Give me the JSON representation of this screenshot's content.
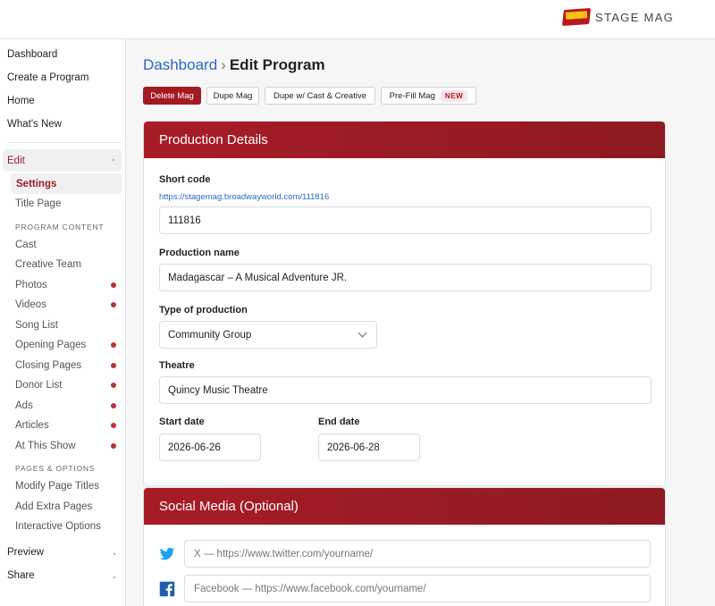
{
  "brand": {
    "name": "STAGE MAG",
    "logo_icon": "stagemag-logo-icon"
  },
  "sidebar": {
    "top_items": [
      "Dashboard",
      "Create a Program",
      "Home",
      "What's New"
    ],
    "edit_label": "Edit",
    "settings_label": "Settings",
    "title_page_label": "Title Page",
    "program_content_heading": "PROGRAM CONTENT",
    "program_content": [
      {
        "label": "Cast",
        "dot": false
      },
      {
        "label": "Creative Team",
        "dot": false
      },
      {
        "label": "Photos",
        "dot": true
      },
      {
        "label": "Videos",
        "dot": true
      },
      {
        "label": "Song List",
        "dot": false
      },
      {
        "label": "Opening Pages",
        "dot": true
      },
      {
        "label": "Closing Pages",
        "dot": true
      },
      {
        "label": "Donor List",
        "dot": true
      },
      {
        "label": "Ads",
        "dot": true
      },
      {
        "label": "Articles",
        "dot": true
      },
      {
        "label": "At This Show",
        "dot": true
      }
    ],
    "pages_options_heading": "PAGES & OPTIONS",
    "pages_options": [
      "Modify Page Titles",
      "Add Extra Pages",
      "Interactive Options"
    ],
    "preview_label": "Preview",
    "share_label": "Share",
    "dot_color": "#b73239"
  },
  "breadcrumb": {
    "parent": "Dashboard",
    "separator": "›",
    "current": "Edit Program"
  },
  "actions": {
    "delete": "Delete Mag",
    "dupe": "Dupe Mag",
    "dupe_cast": "Dupe w/ Cast & Creative",
    "prefill": "Pre-Fill Mag",
    "new_badge": "NEW"
  },
  "production": {
    "heading": "Production Details",
    "short_code_label": "Short code",
    "short_code_url": "https://stagemag.broadwayworld.com/111816",
    "short_code_value": "111816",
    "production_name_label": "Production name",
    "production_name_value": "Madagascar – A Musical Adventure JR.",
    "type_label": "Type of production",
    "type_value": "Community Group",
    "theatre_label": "Theatre",
    "theatre_value": "Quincy Music Theatre",
    "start_label": "Start date",
    "start_value": "2026-06-26",
    "end_label": "End date",
    "end_value": "2026-06-28"
  },
  "social": {
    "heading": "Social Media (Optional)",
    "twitter_placeholder": "X — https://www.twitter.com/yourname/",
    "facebook_placeholder": "Facebook — https://www.facebook.com/yourname/"
  },
  "colors": {
    "accent": "#a31a23",
    "link": "#2c68c3",
    "twitter": "#1da1f2",
    "facebook": "#1877f2"
  }
}
